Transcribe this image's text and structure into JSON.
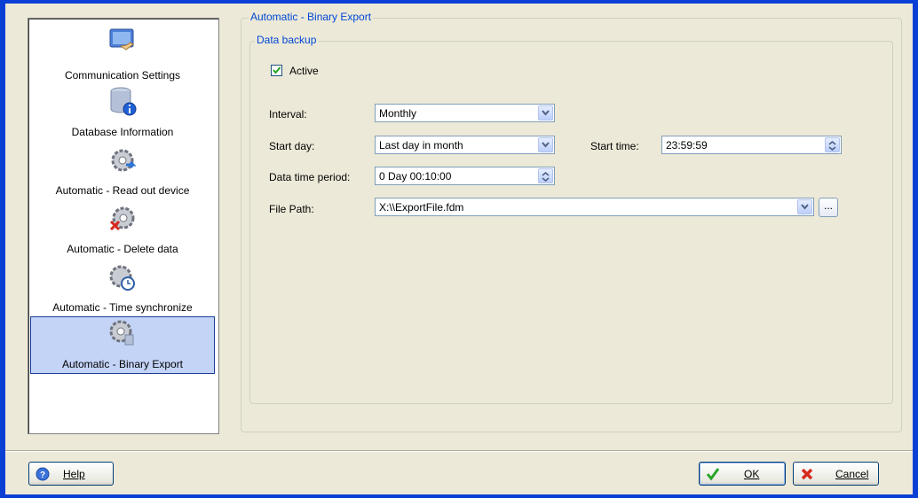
{
  "nav": {
    "items": [
      {
        "label": "Communication Settings",
        "icon": "monitor-hand-icon"
      },
      {
        "label": "Database Information",
        "icon": "database-info-icon"
      },
      {
        "label": "Automatic - Read out device",
        "icon": "gears-readout-icon"
      },
      {
        "label": "Automatic - Delete data",
        "icon": "gears-delete-icon"
      },
      {
        "label": "Automatic - Time synchronize",
        "icon": "gears-clock-icon"
      },
      {
        "label": "Automatic - Binary Export",
        "icon": "gears-export-icon"
      }
    ],
    "selected_index": 5
  },
  "panel": {
    "title": "Automatic - Binary Export",
    "group_title": "Data backup",
    "active_label": "Active",
    "active_checked": true,
    "interval_label": "Interval:",
    "interval_value": "Monthly",
    "start_day_label": "Start day:",
    "start_day_value": "Last day in month",
    "start_time_label": "Start time:",
    "start_time_value": "23:59:59",
    "period_label": "Data time period:",
    "period_value": "0 Day 00:10:00",
    "file_path_label": "File Path:",
    "file_path_value": "X:\\\\ExportFile.fdm",
    "browse_label": "..."
  },
  "footer": {
    "help_label": "Help",
    "ok_label": "OK",
    "cancel_label": "Cancel"
  },
  "colors": {
    "window_frame": "#0a3fd6",
    "dialog_bg": "#ece9d8",
    "group_title": "#0046d5",
    "selection": "#c4d4f7"
  }
}
